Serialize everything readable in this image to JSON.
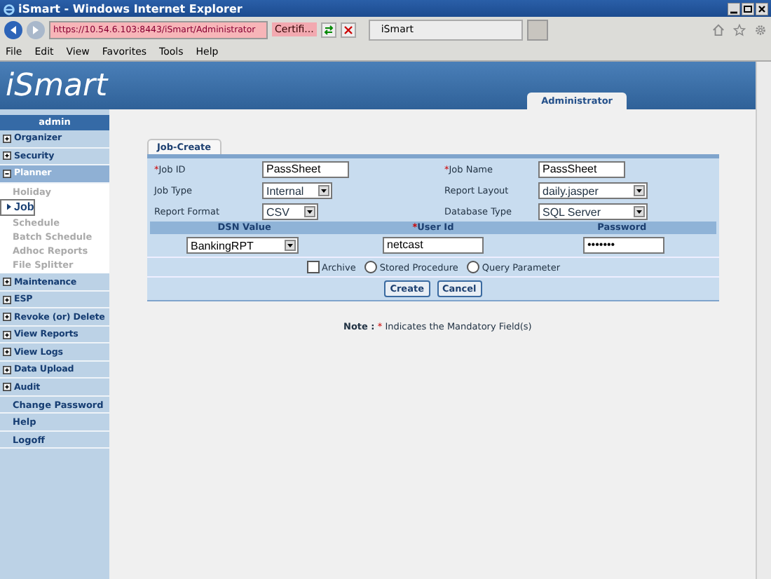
{
  "browser": {
    "title": "iSmart - Windows Internet Explorer",
    "address": "https://10.54.6.103:8443/iSmart/Administrator",
    "certificate": "Certifi...",
    "tab_title": "iSmart",
    "menu": [
      "File",
      "Edit",
      "View",
      "Favorites",
      "Tools",
      "Help"
    ]
  },
  "header": {
    "logo": "iSmart",
    "user_tab": "Administrator"
  },
  "sidebar": {
    "user": "admin",
    "items": [
      {
        "label": "Organizer",
        "kind": "group",
        "expanded": false
      },
      {
        "label": "Security",
        "kind": "group",
        "expanded": false
      },
      {
        "label": "Planner",
        "kind": "group",
        "expanded": true,
        "children": [
          {
            "label": "Holiday",
            "selected": false
          },
          {
            "label": "Job",
            "selected": true
          },
          {
            "label": "Schedule",
            "selected": false
          },
          {
            "label": "Batch Schedule",
            "selected": false
          },
          {
            "label": "Adhoc Reports",
            "selected": false
          },
          {
            "label": "File Splitter",
            "selected": false
          }
        ]
      },
      {
        "label": "Maintenance",
        "kind": "group",
        "expanded": false
      },
      {
        "label": "ESP",
        "kind": "group",
        "expanded": false
      },
      {
        "label": "Revoke (or) Delete",
        "kind": "group",
        "expanded": false
      },
      {
        "label": "View Reports",
        "kind": "group",
        "expanded": false
      },
      {
        "label": "View Logs",
        "kind": "group",
        "expanded": false
      },
      {
        "label": "Data Upload",
        "kind": "group",
        "expanded": false
      },
      {
        "label": "Audit",
        "kind": "group",
        "expanded": false
      },
      {
        "label": "Change Password",
        "kind": "link"
      },
      {
        "label": "Help",
        "kind": "link"
      },
      {
        "label": "Logoff",
        "kind": "link"
      }
    ]
  },
  "form": {
    "tab": "Job-Create",
    "fields": [
      {
        "mark": "*",
        "label": "Job ID",
        "kind": "text",
        "value": "PassSheet"
      },
      {
        "mark": "*",
        "label": "Job Name",
        "kind": "text",
        "value": "PassSheet"
      },
      {
        "label": "Job Type",
        "kind": "select",
        "value": "Internal"
      },
      {
        "label": "Report Layout",
        "kind": "select",
        "value": "daily.jasper"
      },
      {
        "label": "Report Format",
        "kind": "select",
        "value": "CSV"
      },
      {
        "label": "Database Type",
        "kind": "select",
        "value": "SQL Server"
      }
    ],
    "credentials": [
      {
        "label": "DSN Value",
        "kind": "select",
        "value": "BankingRPT"
      },
      {
        "mark": "*",
        "label": "User Id",
        "kind": "text",
        "value": "netcast"
      },
      {
        "label": "Password",
        "kind": "text",
        "value": "•••••••"
      }
    ],
    "options": [
      {
        "label": "Archive",
        "kind": "checkbox",
        "checked": false
      },
      {
        "label": "Stored Procedure",
        "kind": "radio",
        "checked": false
      },
      {
        "label": "Query Parameter",
        "kind": "radio",
        "checked": false
      }
    ],
    "buttons": [
      "Create",
      "Cancel"
    ]
  },
  "note": {
    "label": "Note :",
    "mark": "*",
    "text": "Indicates the Mandatory Field(s)"
  }
}
